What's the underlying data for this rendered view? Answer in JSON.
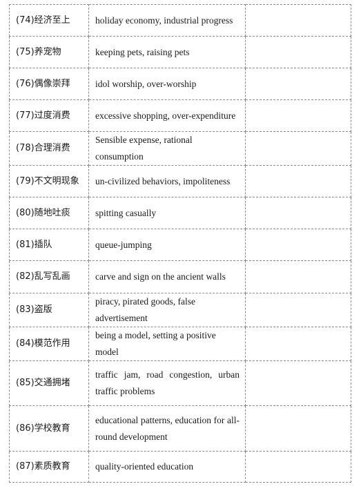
{
  "rows": [
    {
      "term": "(74)经济至上",
      "english": "holiday economy, industrial progress"
    },
    {
      "term": "(75)养宠物",
      "english": "keeping pets, raising pets"
    },
    {
      "term": "(76)偶像崇拜",
      "english": "idol worship, over-worship"
    },
    {
      "term": "(77)过度消费",
      "english": "excessive shopping, over-expenditure"
    },
    {
      "term": "(78)合理消费",
      "english": "Sensible expense, rational consumption"
    },
    {
      "term": "(79)不文明现象",
      "english": "un-civilized behaviors, impoliteness"
    },
    {
      "term": "(80)随地吐痰",
      "english": "spitting casually"
    },
    {
      "term": "(81)插队",
      "english": "queue-jumping"
    },
    {
      "term": "(82)乱写乱画",
      "english": "carve and sign on the ancient walls"
    },
    {
      "term": "(83)盗版",
      "english": "piracy, pirated goods, false advertisement"
    },
    {
      "term": "(84)模范作用",
      "english": "being a model, setting a positive model"
    },
    {
      "term": "(85)交通拥堵",
      "english": "traffic jam, road congestion, urban traffic problems"
    },
    {
      "term": "(86)学校教育",
      "english": "educational patterns, education for all-round development"
    },
    {
      "term": "(87)素质教育",
      "english": "quality-oriented education"
    }
  ]
}
